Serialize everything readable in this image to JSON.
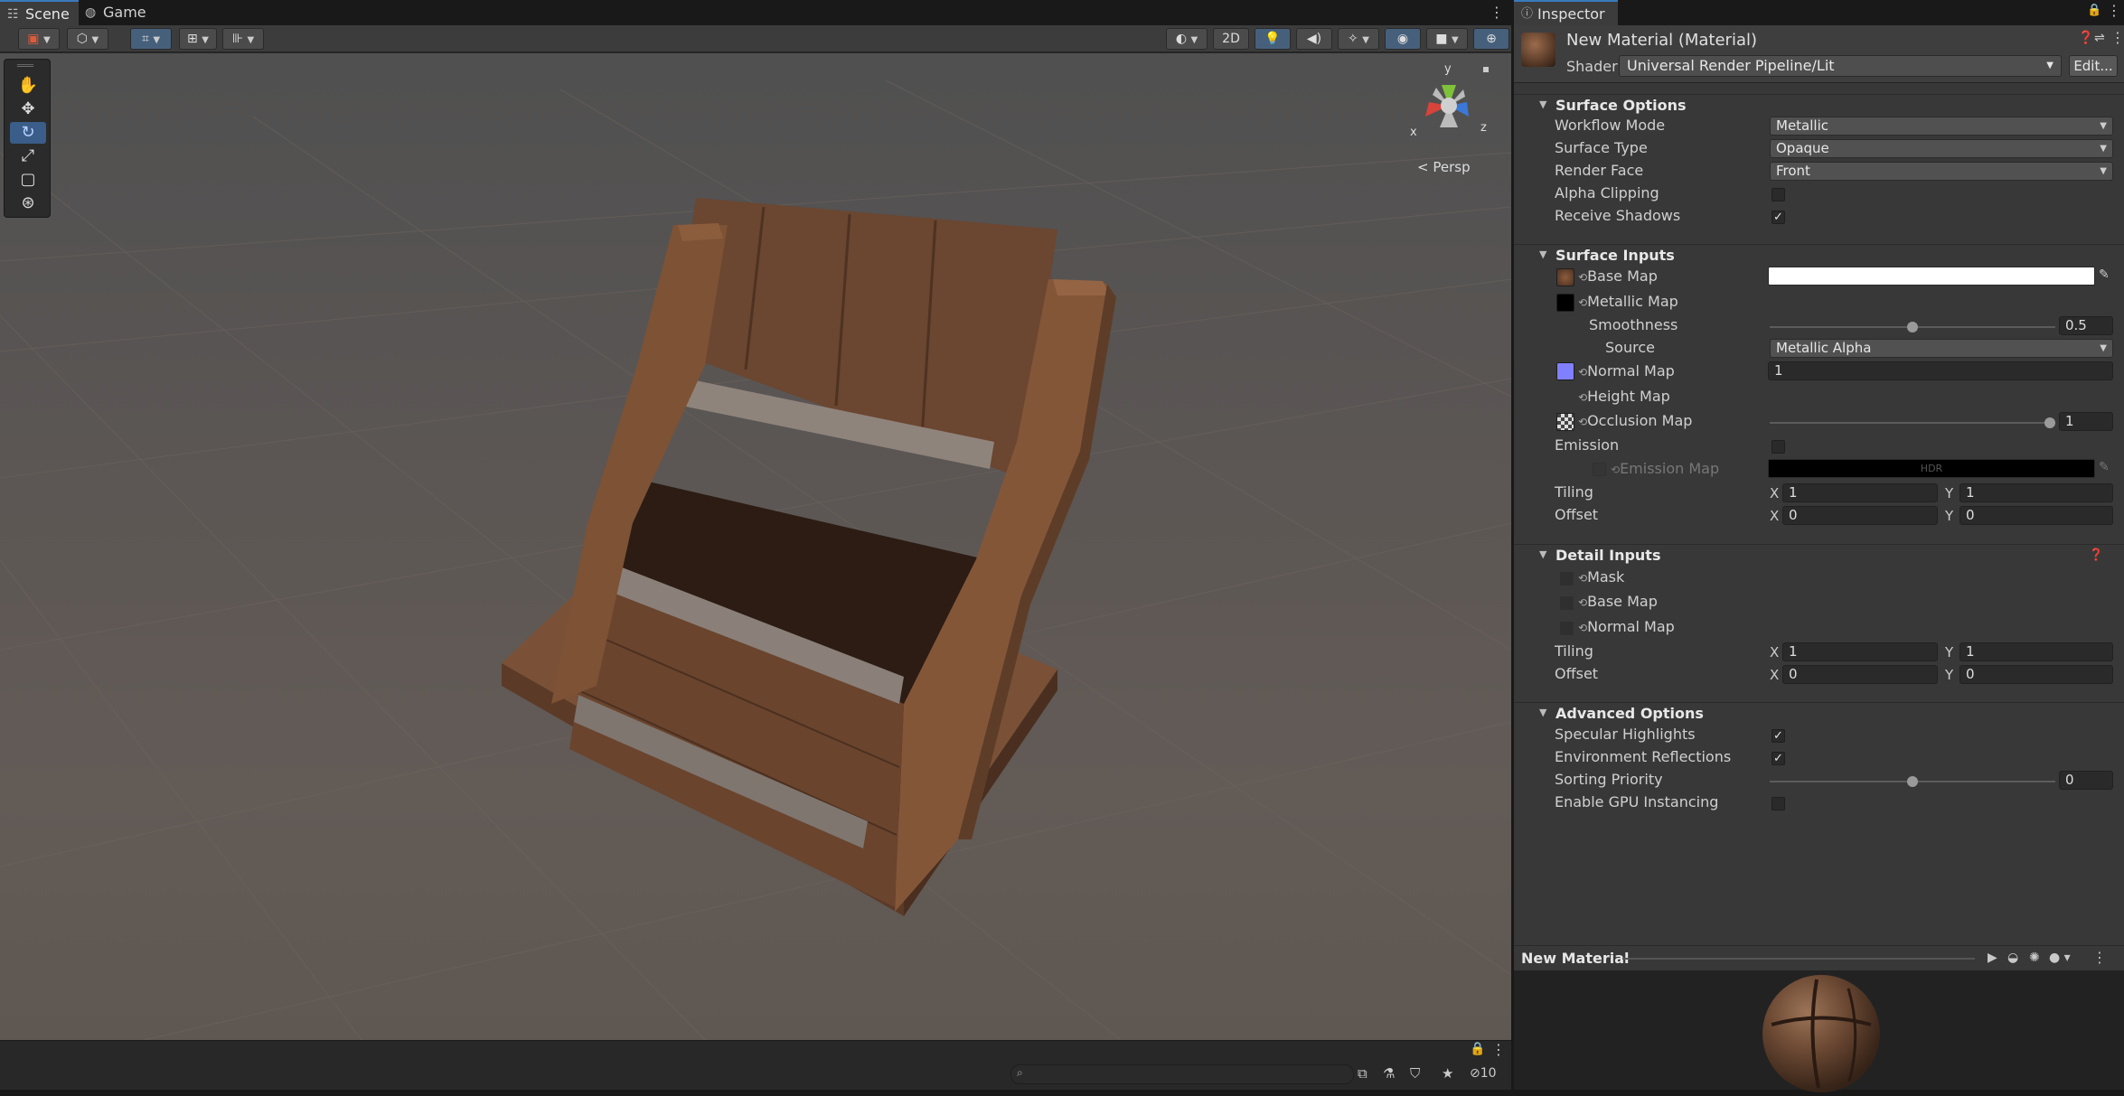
{
  "tabs": {
    "scene": "Scene",
    "game": "Game",
    "inspector": "Inspector"
  },
  "scene_toolbar": {
    "mode_2d": "2D"
  },
  "viewport": {
    "persp_label": "Persp",
    "gizmo_y": "y",
    "gizmo_x": "x",
    "gizmo_z": "z"
  },
  "status": {
    "hidden_count": "10",
    "search_placeholder": ""
  },
  "inspector": {
    "material_title": "New Material (Material)",
    "shader_label": "Shader",
    "shader_value": "Universal Render Pipeline/Lit",
    "edit_button": "Edit...",
    "surface_options": {
      "title": "Surface Options",
      "workflow_mode_label": "Workflow Mode",
      "workflow_mode": "Metallic",
      "surface_type_label": "Surface Type",
      "surface_type": "Opaque",
      "render_face_label": "Render Face",
      "render_face": "Front",
      "alpha_clipping_label": "Alpha Clipping",
      "alpha_clipping": false,
      "receive_shadows_label": "Receive Shadows",
      "receive_shadows": true
    },
    "surface_inputs": {
      "title": "Surface Inputs",
      "base_map": "Base Map",
      "metallic_map": "Metallic Map",
      "smoothness_label": "Smoothness",
      "smoothness": "0.5",
      "source_label": "Source",
      "source": "Metallic Alpha",
      "normal_map": "Normal Map",
      "normal_scale": "1",
      "height_map": "Height Map",
      "occlusion_map": "Occlusion Map",
      "occlusion_strength": "1",
      "emission_label": "Emission",
      "emission_map": "Emission Map",
      "hdr": "HDR",
      "tiling_label": "Tiling",
      "tiling_x": "1",
      "tiling_y": "1",
      "offset_label": "Offset",
      "offset_x": "0",
      "offset_y": "0",
      "x": "X",
      "y": "Y"
    },
    "detail_inputs": {
      "title": "Detail Inputs",
      "mask": "Mask",
      "base_map": "Base Map",
      "normal_map": "Normal Map",
      "tiling_label": "Tiling",
      "tiling_x": "1",
      "tiling_y": "1",
      "offset_label": "Offset",
      "offset_x": "0",
      "offset_y": "0",
      "x": "X",
      "y": "Y"
    },
    "advanced_options": {
      "title": "Advanced Options",
      "specular_highlights": "Specular Highlights",
      "environment_reflections": "Environment Reflections",
      "sorting_priority_label": "Sorting Priority",
      "sorting_priority": "0",
      "gpu_instancing": "Enable GPU Instancing"
    },
    "preview_title": "New Material"
  },
  "colors": {
    "accent": "#3a79bb",
    "selected_tool": "#3a5d89",
    "normal_map_swatch": "#8080ff"
  }
}
